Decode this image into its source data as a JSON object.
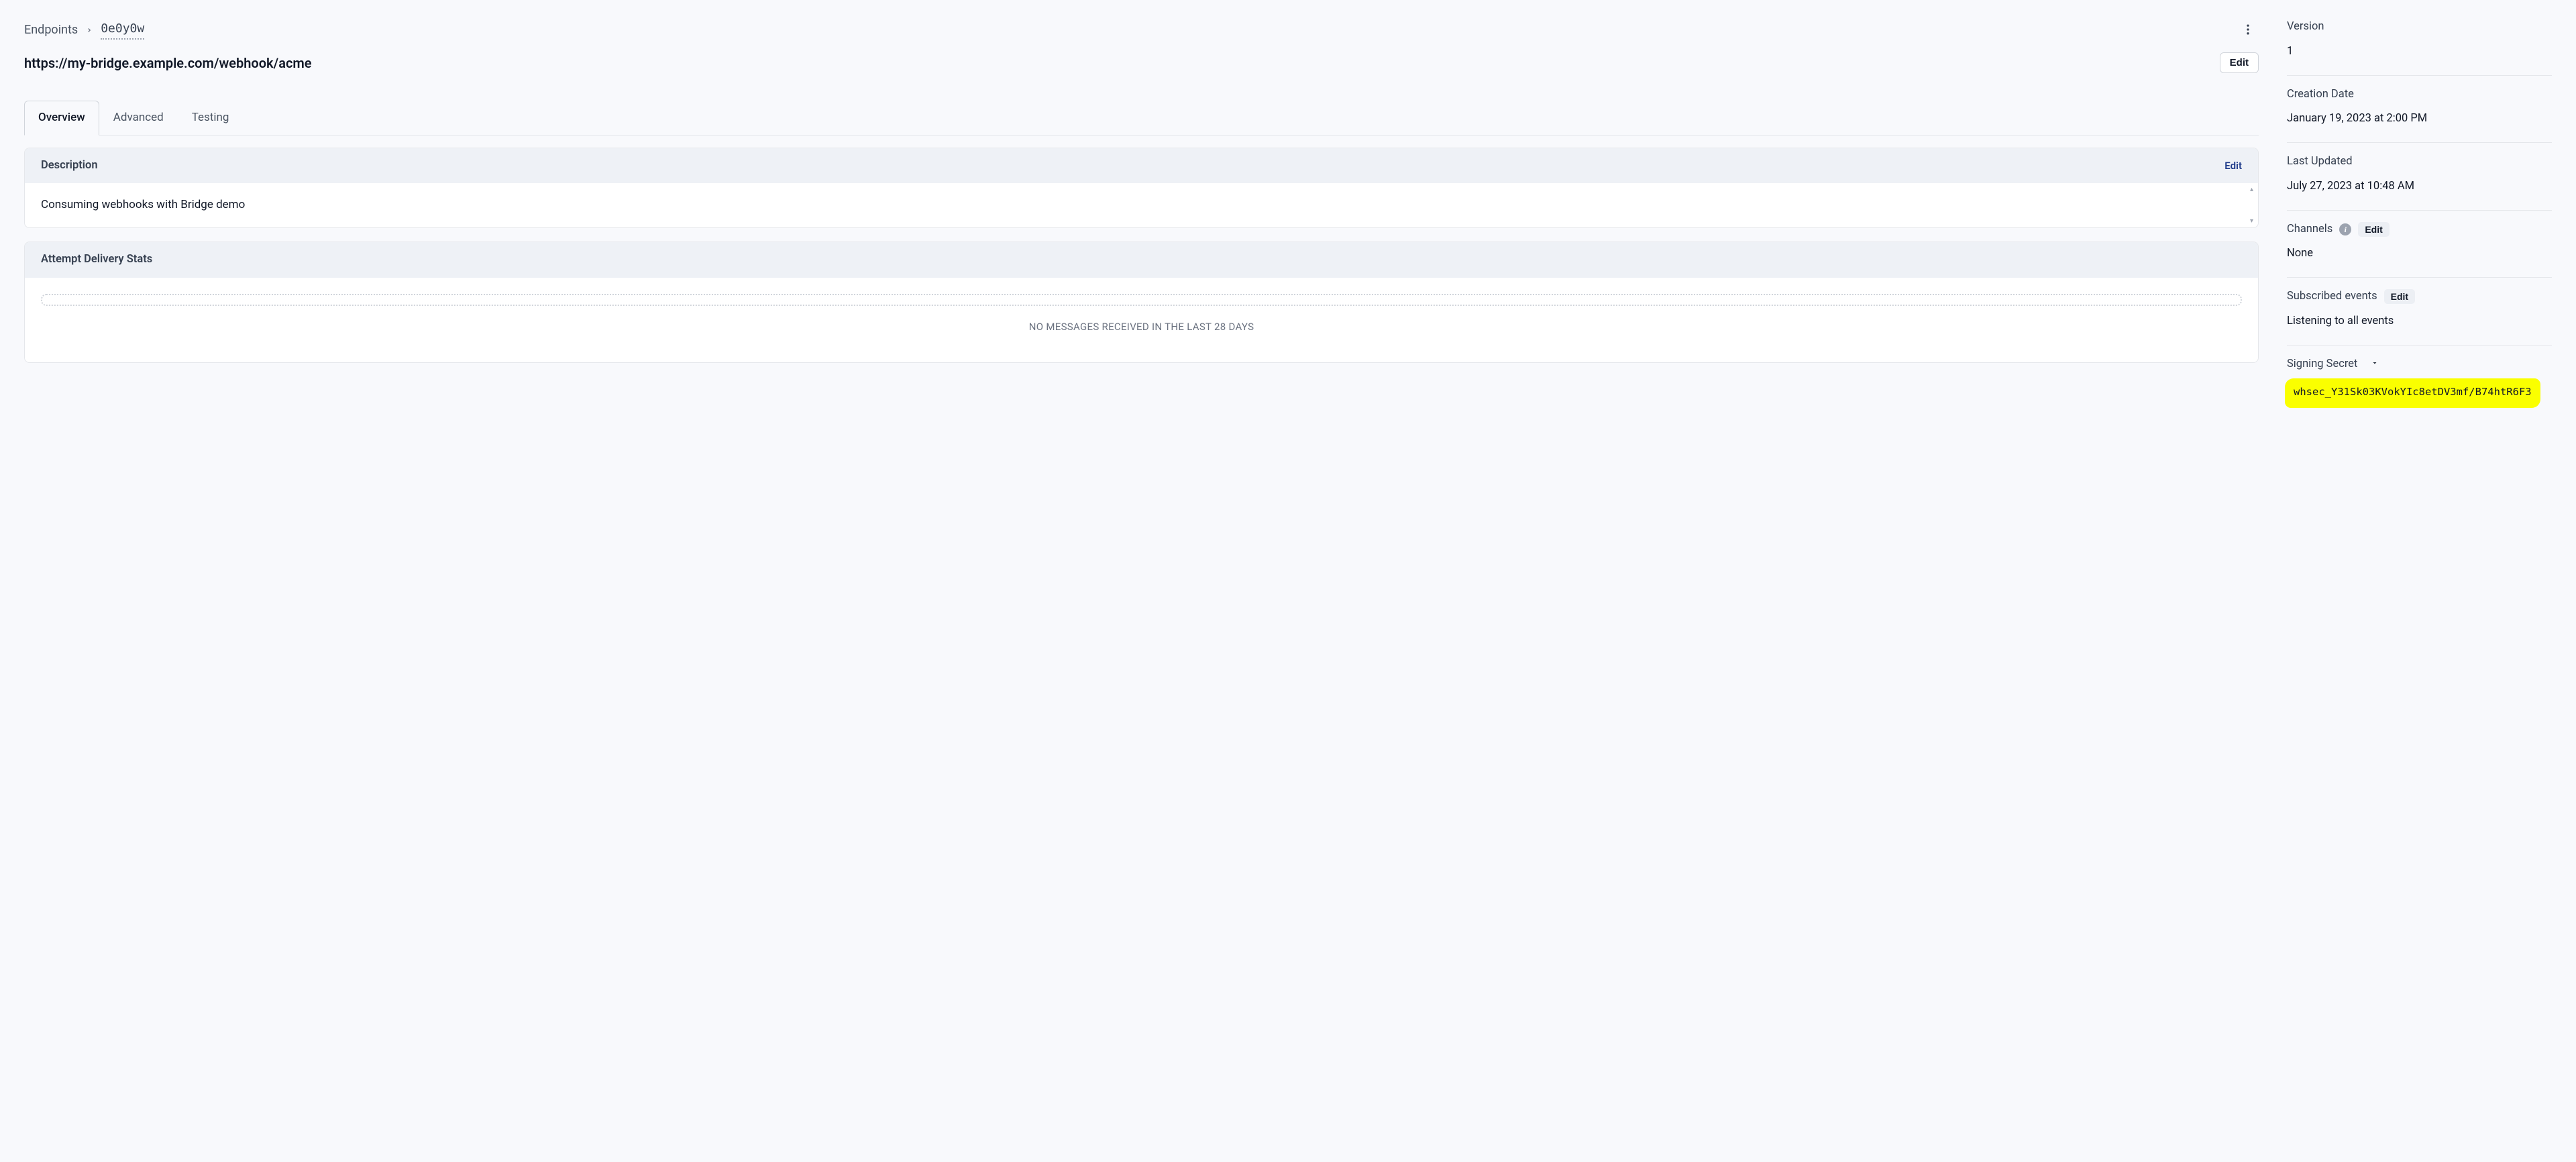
{
  "breadcrumb": {
    "root": "Endpoints",
    "current": "0e0y0w"
  },
  "header": {
    "endpoint_url": "https://my-bridge.example.com/webhook/acme",
    "edit_label": "Edit"
  },
  "tabs": [
    {
      "id": "overview",
      "label": "Overview",
      "active": true
    },
    {
      "id": "advanced",
      "label": "Advanced",
      "active": false
    },
    {
      "id": "testing",
      "label": "Testing",
      "active": false
    }
  ],
  "description_card": {
    "title": "Description",
    "edit_label": "Edit",
    "text": "Consuming webhooks with Bridge demo"
  },
  "stats_card": {
    "title": "Attempt Delivery Stats",
    "empty_message": "NO MESSAGES RECEIVED IN THE LAST 28 DAYS"
  },
  "sidebar": {
    "version": {
      "label": "Version",
      "value": "1"
    },
    "creation_date": {
      "label": "Creation Date",
      "value": "January 19, 2023 at 2:00 PM"
    },
    "last_updated": {
      "label": "Last Updated",
      "value": "July 27, 2023 at 10:48 AM"
    },
    "channels": {
      "label": "Channels",
      "edit_label": "Edit",
      "value": "None"
    },
    "subscribed_events": {
      "label": "Subscribed events",
      "edit_label": "Edit",
      "value": "Listening to all events"
    },
    "signing_secret": {
      "label": "Signing Secret",
      "value": "whsec_Y31Sk03KVokYIc8etDV3mf/B74htR6F3"
    }
  }
}
